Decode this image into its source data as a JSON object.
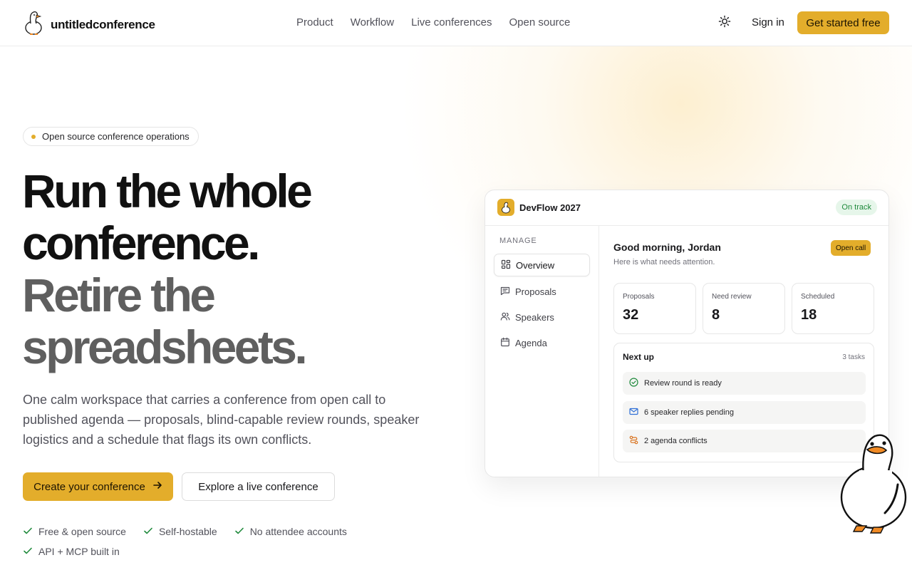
{
  "brand": {
    "name": "untitledconference"
  },
  "nav": {
    "links": [
      "Product",
      "Workflow",
      "Live conferences",
      "Open source"
    ],
    "sign_in": "Sign in",
    "cta": "Get started free"
  },
  "hero": {
    "pill": "Open source conference operations",
    "headline_dark": [
      "Run the whole",
      "conference."
    ],
    "headline_muted": [
      "Retire the",
      "spreadsheets."
    ],
    "lede": "One calm workspace that carries a conference from open call to published agenda — proposals, blind-capable review rounds, speaker logistics and a schedule that flags its own conflicts.",
    "primary_button": "Create your conference",
    "secondary_button": "Explore a live conference",
    "features": [
      "Free & open source",
      "Self-hostable",
      "No attendee accounts",
      "API + MCP built in"
    ]
  },
  "dashboard": {
    "conference_name": "DevFlow 2027",
    "status_badge": "On track",
    "sidebar": {
      "section_title": "MANAGE",
      "items": [
        {
          "label": "Overview",
          "icon": "grid-icon",
          "active": true
        },
        {
          "label": "Proposals",
          "icon": "message-icon",
          "active": false
        },
        {
          "label": "Speakers",
          "icon": "users-icon",
          "active": false
        },
        {
          "label": "Agenda",
          "icon": "calendar-icon",
          "active": false
        }
      ]
    },
    "greeting": "Good morning, Jordan",
    "greeting_sub": "Here is what needs attention.",
    "open_call_badge": "Open call",
    "stats": [
      {
        "label": "Proposals",
        "value": "32"
      },
      {
        "label": "Need review",
        "value": "8"
      },
      {
        "label": "Scheduled",
        "value": "18"
      }
    ],
    "next_up": {
      "title": "Next up",
      "count": "3 tasks",
      "tasks": [
        {
          "label": "Review round is ready",
          "icon": "check-circle-icon",
          "color": "#1f8a3c"
        },
        {
          "label": "6 speaker replies pending",
          "icon": "mail-icon",
          "color": "#2f6fd6"
        },
        {
          "label": "2 agenda conflicts",
          "icon": "conflict-icon",
          "color": "#d9731f"
        }
      ]
    }
  },
  "colors": {
    "accent": "#e3ad2b",
    "success": "#1f8a3c",
    "text": "#18181b",
    "muted": "#52525b"
  }
}
